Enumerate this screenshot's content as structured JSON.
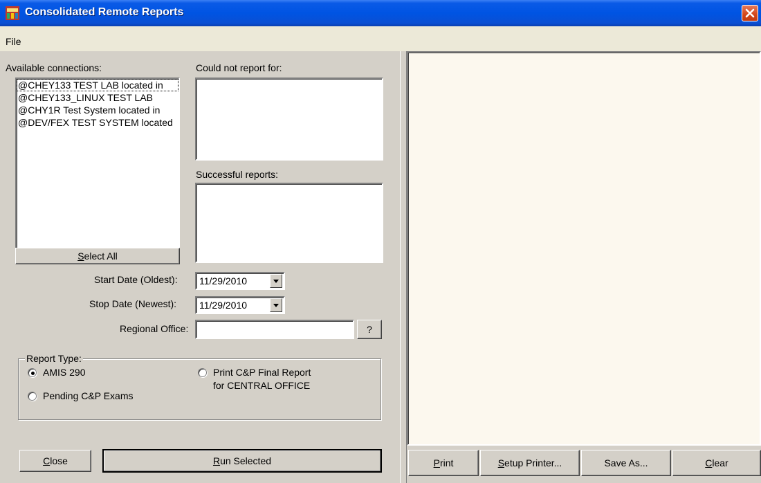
{
  "window": {
    "title": "Consolidated Remote Reports"
  },
  "menu": {
    "file": "File"
  },
  "available_connections": {
    "label": "Available connections:",
    "items": [
      "@CHEY133 TEST LAB located in",
      "@CHEY133_LINUX TEST LAB",
      "@CHY1R Test System located in",
      "@DEV/FEX TEST SYSTEM located"
    ],
    "select_all": "Select All"
  },
  "could_not_report": {
    "label": "Could not report for:"
  },
  "successful_reports": {
    "label": "Successful reports:"
  },
  "start_date": {
    "label": "Start Date (Oldest):",
    "value": "11/29/2010"
  },
  "stop_date": {
    "label": "Stop Date (Newest):",
    "value": "11/29/2010"
  },
  "regional_office": {
    "label": "Regional Office:",
    "value": "",
    "lookup": "?"
  },
  "report_type": {
    "label": "Report Type:",
    "options": [
      {
        "label": "AMIS 290",
        "selected": true
      },
      {
        "label": "Pending C&P Exams",
        "selected": false
      },
      {
        "label": "Print C&P Final Report",
        "label2": "for CENTRAL OFFICE",
        "selected": false
      }
    ]
  },
  "buttons": {
    "close": "Close",
    "run_selected": "Run Selected",
    "print": "Print",
    "setup_printer": "Setup Printer...",
    "save_as": "Save As...",
    "clear": "Clear"
  }
}
